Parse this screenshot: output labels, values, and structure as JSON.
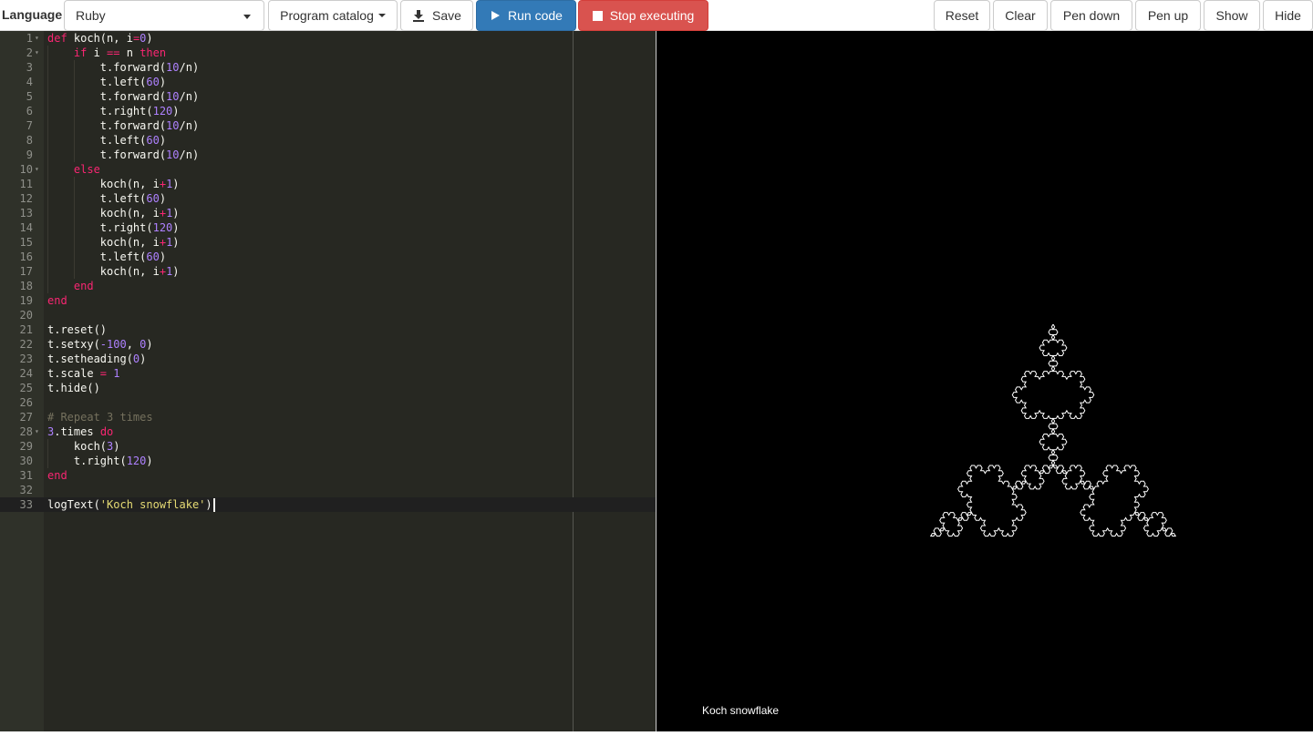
{
  "toolbar": {
    "language_label": "Language",
    "language_value": "Ruby",
    "catalog_label": "Program catalog",
    "save_label": "Save",
    "run_label": "Run code",
    "stop_label": "Stop executing",
    "reset_label": "Reset",
    "clear_label": "Clear",
    "pen_down_label": "Pen down",
    "pen_up_label": "Pen up",
    "show_label": "Show",
    "hide_label": "Hide"
  },
  "editor": {
    "lines": [
      "def koch(n, i=0)",
      "    if i == n then",
      "        t.forward(10/n)",
      "        t.left(60)",
      "        t.forward(10/n)",
      "        t.right(120)",
      "        t.forward(10/n)",
      "        t.left(60)",
      "        t.forward(10/n)",
      "    else",
      "        koch(n, i+1)",
      "        t.left(60)",
      "        koch(n, i+1)",
      "        t.right(120)",
      "        koch(n, i+1)",
      "        t.left(60)",
      "        koch(n, i+1)",
      "    end",
      "end",
      "",
      "t.reset()",
      "t.setxy(-100, 0)",
      "t.setheading(0)",
      "t.scale = 1",
      "t.hide()",
      "",
      "# Repeat 3 times",
      "3.times do",
      "    koch(3)",
      "    t.right(120)",
      "end",
      "",
      "logText('Koch snowflake')"
    ],
    "fold_lines": [
      1,
      2,
      10,
      28
    ],
    "active_line": 33
  },
  "canvas": {
    "log_text": "Koch snowflake",
    "stroke_color": "#ffffff",
    "background": "#000000",
    "koch_depth": 4
  },
  "colors": {
    "primary": "#337ab7",
    "danger": "#d9534f",
    "editor_bg": "#272822"
  }
}
